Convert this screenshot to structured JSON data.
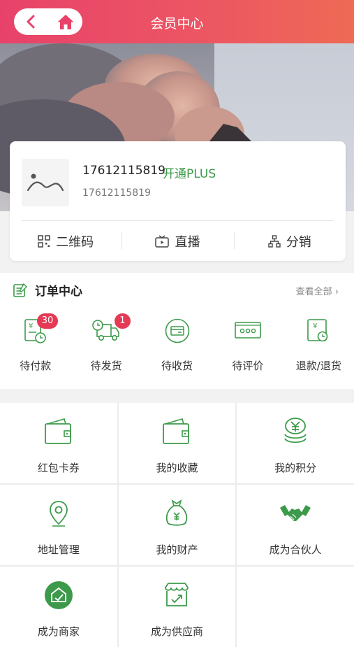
{
  "header": {
    "title": "会员中心"
  },
  "profile": {
    "phone": "17612115819",
    "plus_label": "开通PLUS",
    "sub_phone": "17612115819",
    "actions": [
      {
        "label": "二维码",
        "icon": "qrcode-icon"
      },
      {
        "label": "直播",
        "icon": "tv-icon"
      },
      {
        "label": "分销",
        "icon": "org-chart-icon"
      }
    ]
  },
  "orders": {
    "title": "订单中心",
    "view_all": "查看全部",
    "items": [
      {
        "label": "待付款",
        "badge": "30",
        "icon": "bill-clock-icon"
      },
      {
        "label": "待发货",
        "badge": "1",
        "icon": "truck-clock-icon"
      },
      {
        "label": "待收货",
        "badge": "",
        "icon": "package-icon"
      },
      {
        "label": "待评价",
        "badge": "",
        "icon": "comment-icon"
      },
      {
        "label": "退款/退货",
        "badge": "",
        "icon": "refund-icon"
      }
    ]
  },
  "services": [
    {
      "label": "红包卡券",
      "icon": "wallet-icon"
    },
    {
      "label": "我的收藏",
      "icon": "wallet-icon"
    },
    {
      "label": "我的积分",
      "icon": "yen-coins-icon"
    },
    {
      "label": "地址管理",
      "icon": "location-pin-icon"
    },
    {
      "label": "我的财产",
      "icon": "money-bag-icon"
    },
    {
      "label": "成为合伙人",
      "icon": "handshake-icon"
    },
    {
      "label": "成为商家",
      "icon": "shop-badge-icon"
    },
    {
      "label": "成为供应商",
      "icon": "supplier-box-icon"
    },
    {
      "label": "",
      "icon": ""
    }
  ],
  "colors": {
    "accent_green": "#3c9a4a",
    "header_red": "#e8426a",
    "badge_red": "#e53a56"
  }
}
